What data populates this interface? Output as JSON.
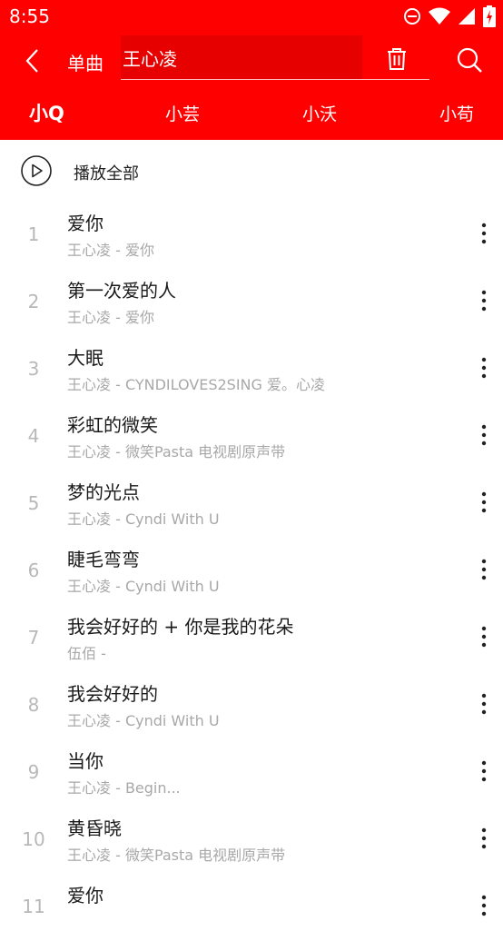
{
  "status_bar": {
    "time": "8:55",
    "icons": [
      "do-not-disturb-icon",
      "wifi-icon",
      "cellular-signal-icon",
      "battery-charging-icon"
    ]
  },
  "toolbar": {
    "title": "单曲",
    "search_value": "王心凌",
    "icons": [
      "back-arrow-icon",
      "trash-icon",
      "search-icon"
    ]
  },
  "tabs": [
    {
      "label": "小Q",
      "active": true
    },
    {
      "label": "小芸",
      "active": false
    },
    {
      "label": "小沃",
      "active": false
    },
    {
      "label": "小苟",
      "active": false
    }
  ],
  "play_all": {
    "label": "播放全部"
  },
  "songs": [
    {
      "num": "1",
      "title": "爱你",
      "subtitle": "王心凌 - 爱你"
    },
    {
      "num": "2",
      "title": "第一次爱的人",
      "subtitle": "王心凌 - 爱你"
    },
    {
      "num": "3",
      "title": "大眠",
      "subtitle": "王心凌 - CYNDILOVES2SING 爱。心凌"
    },
    {
      "num": "4",
      "title": "彩虹的微笑",
      "subtitle": "王心凌 - 微笑Pasta 电视剧原声带"
    },
    {
      "num": "5",
      "title": "梦的光点",
      "subtitle": "王心凌 - Cyndi With U"
    },
    {
      "num": "6",
      "title": "睫毛弯弯",
      "subtitle": "王心凌 - Cyndi With U"
    },
    {
      "num": "7",
      "title": "我会好好的 + 你是我的花朵",
      "subtitle": "伍佰 -"
    },
    {
      "num": "8",
      "title": "我会好好的",
      "subtitle": "王心凌 - Cyndi With U"
    },
    {
      "num": "9",
      "title": "当你",
      "subtitle": "王心凌 - Begin..."
    },
    {
      "num": "10",
      "title": "黄昏晓",
      "subtitle": "王心凌 - 微笑Pasta 电视剧原声带"
    },
    {
      "num": "11",
      "title": "爱你",
      "subtitle": ""
    }
  ],
  "colors": {
    "accent": "#ff0000",
    "search_bg": "#e60000",
    "title_text": "#1a1a1a",
    "sub_text": "#a8a8a8"
  }
}
